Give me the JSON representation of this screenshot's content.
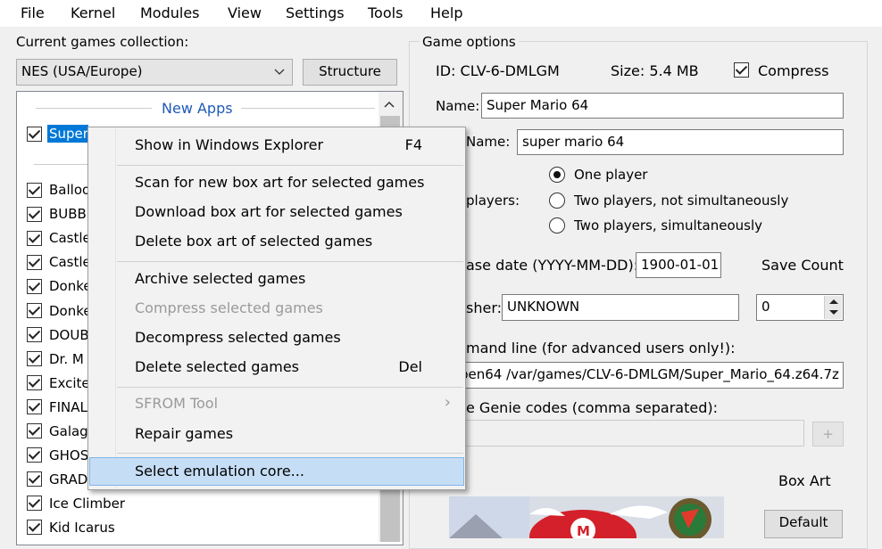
{
  "menubar": [
    "File",
    "Kernel",
    "Modules",
    "View",
    "Settings",
    "Tools",
    "Help"
  ],
  "left": {
    "collection_label": "Current games collection:",
    "collection_value": "NES (USA/Europe)",
    "structure_button": "Structure",
    "folder_title": "New Apps",
    "selected_game": "Super",
    "games": [
      "Balloo",
      "BUBB",
      "Castle",
      "Castle",
      "Donke",
      "Donke",
      "DOUB",
      "Dr. M",
      "Excite",
      "FINAL",
      "Galag",
      "GHOS",
      "GRAD",
      "Ice Climber",
      "Kid Icarus"
    ]
  },
  "context_menu": {
    "items": [
      {
        "label": "Show in Windows Explorer",
        "shortcut": "F4"
      },
      {
        "label": "Scan for new box art for selected games"
      },
      {
        "label": "Download box art for selected games"
      },
      {
        "label": "Delete box art of selected games"
      },
      {
        "label": "Archive selected games"
      },
      {
        "label": "Compress selected games"
      },
      {
        "label": "Decompress selected games"
      },
      {
        "label": "Delete selected games",
        "shortcut": "Del"
      },
      {
        "label": "SFROM Tool"
      },
      {
        "label": "Repair games"
      },
      {
        "label": "Select emulation core..."
      }
    ],
    "submenu_arrow": "›"
  },
  "options": {
    "group_title": "Game options",
    "id_text": "ID: CLV-6-DMLGM",
    "size_text": "Size: 5.4 MB",
    "compress_label": "Compress",
    "name_label": "Name:",
    "name_value": "Super Mario 64",
    "sort_name_label": "Name:",
    "sort_name_value": "super mario 64",
    "players_label": "players:",
    "radio_one": "One player",
    "radio_two_not_sim": "Two players, not simultaneously",
    "radio_two_sim": "Two players, simultaneously",
    "release_label": "ase date (YYYY-MM-DD):",
    "release_value": "1900-01-01",
    "save_count_label": "Save Count",
    "publisher_label": "sher:",
    "publisher_value": "UNKNOWN",
    "save_count_value": "0",
    "command_label": "mand line (for advanced users only!):",
    "command_value": "pen64 /var/games/CLV-6-DMLGM/Super_Mario_64.z64.7z",
    "genie_label": "e Genie codes (comma separated):",
    "genie_value": "",
    "genie_button": "+",
    "box_art_label": "Box Art",
    "default_button": "Default"
  },
  "colors": {
    "highlight": "#c6def5",
    "selected": "#0078d7"
  }
}
